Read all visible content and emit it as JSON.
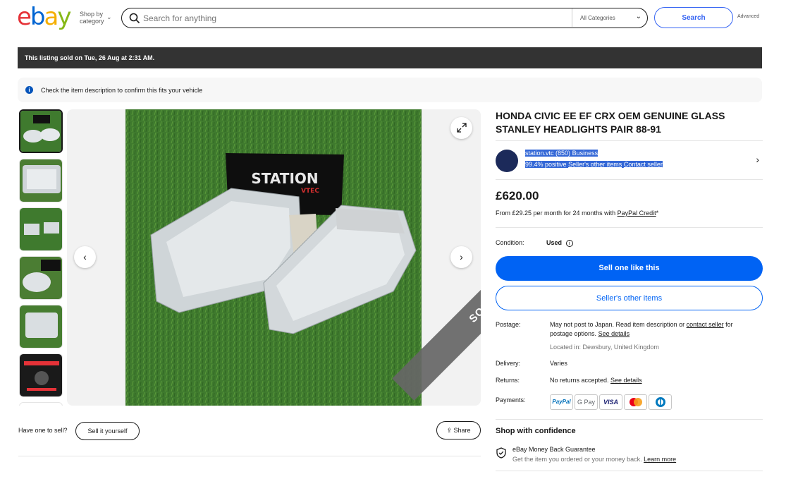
{
  "header": {
    "logo": {
      "e": "e",
      "b": "b",
      "a": "a",
      "y": "y"
    },
    "shop_by_line1": "Shop by",
    "shop_by_line2": "category",
    "search_placeholder": "Search for anything",
    "category_select": "All Categories",
    "search_button": "Search",
    "advanced": "Advanced"
  },
  "banner": {
    "sold_text": "This listing sold on Tue, 26 Aug at 2:31 AM.",
    "notice_text": "Check the item description to confirm this fits your vehicle"
  },
  "gallery": {
    "thumbnail_count": 6,
    "sold_ribbon": "SOLD",
    "photo_sign_line1": "STATION",
    "photo_sign_line2": "VTEC"
  },
  "below_image": {
    "have_one": "Have one to sell?",
    "sell_button": "Sell it yourself",
    "share_button": "Share"
  },
  "listing": {
    "title": "HONDA CIVIC EE EF CRX OEM GENUINE GLASS STANLEY HEADLIGHTS PAIR 88-91",
    "seller_name": "station.vtc",
    "seller_score": "(850)",
    "seller_type": "Business",
    "seller_positive": "99.4% positive",
    "seller_other_items": "Seller's other items",
    "contact_seller": "Contact seller",
    "price": "£620.00",
    "finance_prefix": "From £29.25 per month for 24 months with ",
    "finance_link": "PayPal Credit",
    "finance_suffix": "*",
    "condition_label": "Condition:",
    "condition_value": "Used",
    "sell_one_like_this": "Sell one like this",
    "sellers_other_items_btn": "Seller's other items",
    "postage_label": "Postage:",
    "postage_text1": "May not post to Japan. Read item description or ",
    "postage_link1": "contact seller",
    "postage_text2": " for",
    "postage_text3": "postage options. ",
    "postage_link2": "See details",
    "located_in": "Located in: Dewsbury, United Kingdom",
    "delivery_label": "Delivery:",
    "delivery_value": "Varies",
    "returns_label": "Returns:",
    "returns_value": "No returns accepted. ",
    "returns_link": "See details",
    "payments_label": "Payments:",
    "payments": [
      "PayPal",
      "G Pay",
      "VISA",
      "Mastercard",
      "Diners"
    ]
  },
  "confidence": {
    "title": "Shop with confidence",
    "guarantee_title": "eBay Money Back Guarantee",
    "guarantee_text": "Get the item you ordered or your money back. ",
    "learn_more": "Learn more"
  }
}
